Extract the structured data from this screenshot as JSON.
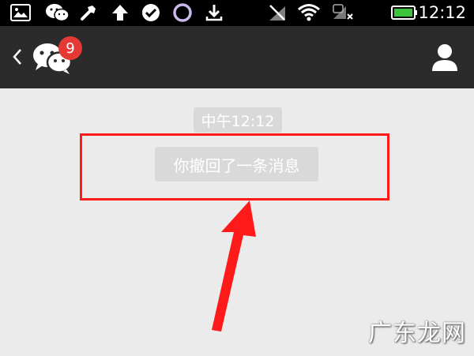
{
  "status_bar": {
    "time": "12:12",
    "icons": [
      "image-icon",
      "wechat-notification-icon",
      "wrench-icon",
      "upload-arrow-icon",
      "check-circle-icon",
      "record-icon",
      "download-icon",
      "no-sim-icon",
      "wifi-icon",
      "data-icon",
      "battery-icon"
    ]
  },
  "title_bar": {
    "unread_badge": "9"
  },
  "chat": {
    "timestamp": "中午12:12",
    "system_message": "你撤回了一条消息"
  },
  "watermark": "广东龙网",
  "colors": {
    "highlight": "#ff1a1a",
    "badge": "#e53935",
    "title_bar_bg": "#2b2b2b",
    "battery_green": "#3cc33c"
  }
}
